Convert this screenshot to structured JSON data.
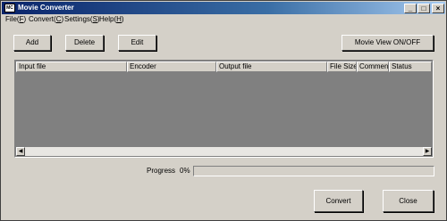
{
  "window": {
    "title": "Movie Converter",
    "app_icon_text": "MC",
    "controls": {
      "minimize": "_",
      "maximize": "□",
      "close": "×"
    }
  },
  "menu": [
    {
      "pre": "File(",
      "key": "F",
      "post": ")"
    },
    {
      "pre": "Convert(",
      "key": "C",
      "post": ")"
    },
    {
      "pre": "Settings(",
      "key": "S",
      "post": ")"
    },
    {
      "pre": "Help(",
      "key": "H",
      "post": ")"
    }
  ],
  "toolbar": {
    "add_label": "Add",
    "delete_label": "Delete",
    "edit_label": "Edit",
    "movie_view_label": "Movie View ON/OFF"
  },
  "list": {
    "columns": [
      "Input file",
      "Encoder",
      "Output file",
      "File Size",
      "Comment",
      "Status"
    ],
    "rows": []
  },
  "scroll": {
    "left_arrow": "◀",
    "right_arrow": "▶"
  },
  "progress": {
    "label": "Progress",
    "percent_text": "0%",
    "value": 0
  },
  "footer": {
    "convert_label": "Convert",
    "close_label": "Close"
  }
}
